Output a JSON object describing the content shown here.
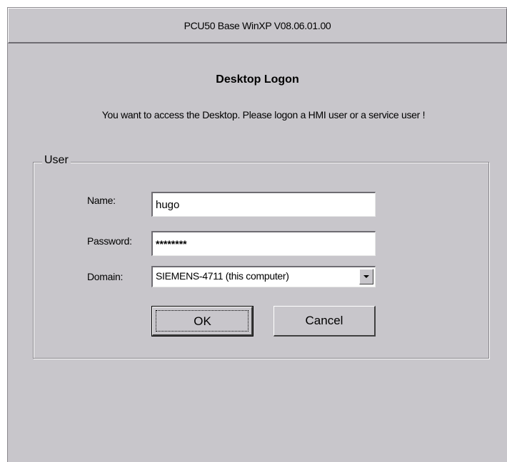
{
  "window": {
    "title": "PCU50 Base WinXP V08.06.01.00"
  },
  "dialog": {
    "heading": "Desktop Logon",
    "message": "You want to access the Desktop.  Please logon a HMI user or a service user !",
    "group_label": "User",
    "name_label": "Name:",
    "name_value": "hugo",
    "password_label": "Password:",
    "password_value": "********",
    "domain_label": "Domain:",
    "domain_value": "SIEMENS-4711 (this computer)",
    "ok_label": "OK",
    "cancel_label": "Cancel"
  },
  "icons": {
    "dropdown": "chevron-down-icon"
  },
  "colors": {
    "window_background": "#c8c6cb",
    "field_background": "#ffffff"
  }
}
